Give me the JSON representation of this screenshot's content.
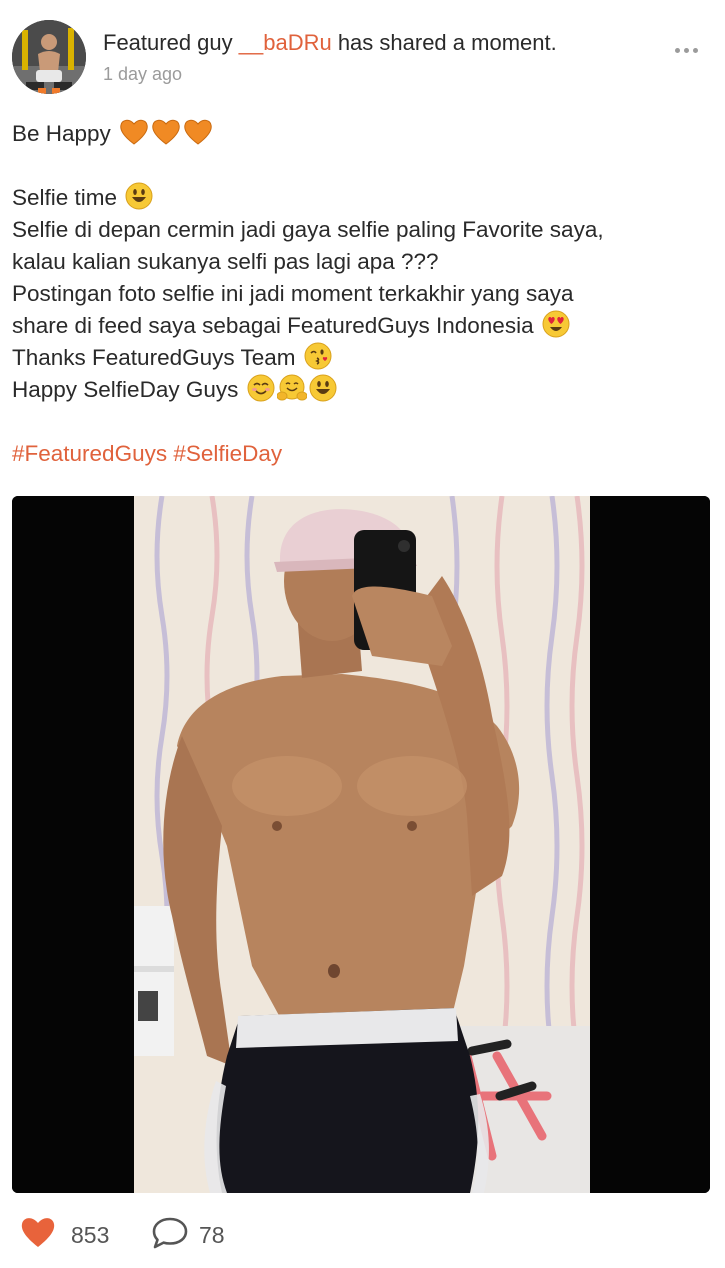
{
  "post": {
    "headline_prefix": "Featured guy ",
    "username": "__baDRu",
    "headline_suffix": " has shared a moment.",
    "timestamp": "1 day ago"
  },
  "caption": {
    "line1": "Be Happy",
    "line2": "Selfie time",
    "line3": "Selfie di depan cermin jadi gaya selfie paling Favorite saya,",
    "line4": "kalau kalian sukanya selfi pas lagi apa ???",
    "line5": "Postingan foto selfie ini jadi moment terkakhir yang saya",
    "line6": "share di feed saya sebagai FeaturedGuys Indonesia",
    "line7": "Thanks FeaturedGuys Team",
    "line8": "Happy SelfieDay Guys"
  },
  "hashtags": [
    "#FeaturedGuys",
    "#SelfieDay"
  ],
  "stats": {
    "likes": "853",
    "comments": "78"
  },
  "colors": {
    "accent": "#e0623c",
    "heart": "#e8633b"
  },
  "icons": [
    "more-options-icon",
    "orange-heart-emoji",
    "smiley-emoji",
    "heart-eyes-emoji",
    "kiss-emoji",
    "blush-emoji",
    "hug-emoji",
    "like-heart-icon",
    "comment-bubble-icon"
  ]
}
